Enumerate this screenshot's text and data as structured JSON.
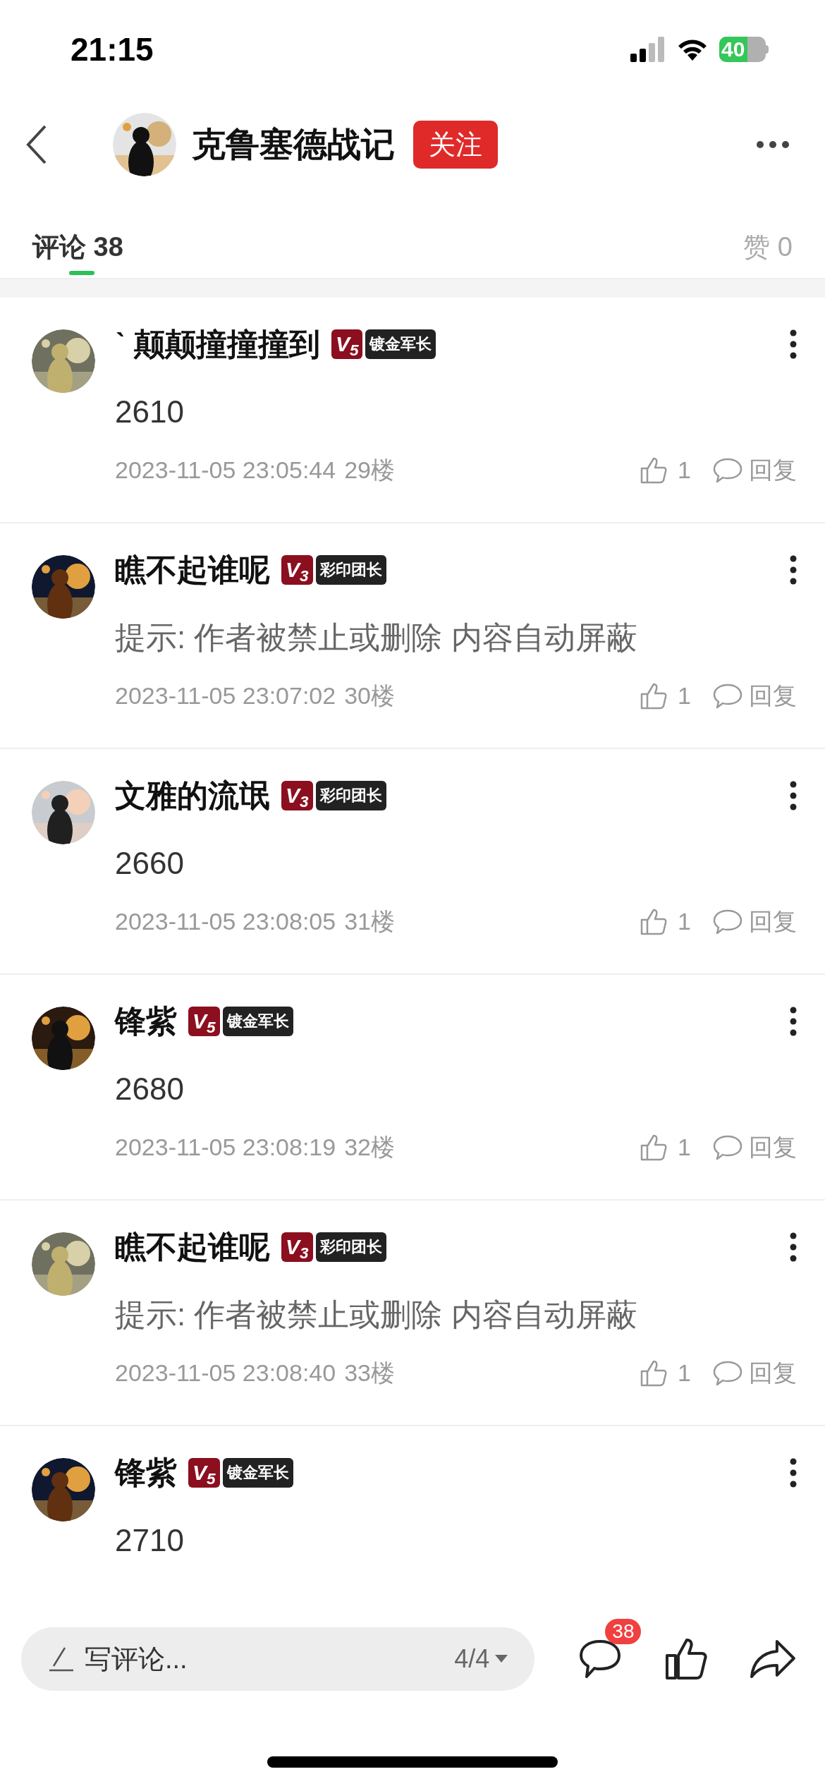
{
  "status_bar": {
    "time": "21:15",
    "battery": "40"
  },
  "header": {
    "title": "克鲁塞德战记",
    "follow_button": "关注"
  },
  "tabs": [
    {
      "label": "评论",
      "count": "38",
      "selected": true
    },
    {
      "label": "赞",
      "count": "0",
      "selected": false
    }
  ],
  "comments": [
    {
      "user": "ˋ 颠颠撞撞撞到",
      "rank": "V$_{5}$",
      "title": "镀金军长",
      "content": "2610",
      "kind": "normal",
      "time": "2023-11-05 23:05:44",
      "floor": "29楼",
      "likes": "1",
      "reply": "回复"
    },
    {
      "user": "瞧不起谁呢",
      "rank": "V$_{3}$",
      "title": "彩印团长",
      "content": "提示: 作者被禁止或删除 内容自动屏蔽",
      "kind": "blocked",
      "time": "2023-11-05 23:07:02",
      "floor": "30楼",
      "likes": "1",
      "reply": "回复"
    },
    {
      "user": "文雅的流氓",
      "rank": "V$_{3}$",
      "title": "彩印团长",
      "content": "2660",
      "kind": "normal",
      "time": "2023-11-05 23:08:05",
      "floor": "31楼",
      "likes": "1",
      "reply": "回复"
    },
    {
      "user": "锋紫",
      "rank": "V$_{5}$",
      "title": "镀金军长",
      "content": "2680",
      "kind": "normal",
      "time": "2023-11-05 23:08:19",
      "floor": "32楼",
      "likes": "1",
      "reply": "回复"
    },
    {
      "user": "瞧不起谁呢",
      "rank": "V$_{3}$",
      "title": "彩印团长",
      "content": "提示: 作者被禁止或删除 内容自动屏蔽",
      "kind": "blocked",
      "time": "2023-11-05 23:08:40",
      "floor": "33楼",
      "likes": "1",
      "reply": "回复"
    },
    {
      "user": "锋紫",
      "rank": "V$_{5}$",
      "title": "镀金军长",
      "content": "2710",
      "kind": "normal"
    }
  ],
  "bottom_bar": {
    "placeholder": "写评论...",
    "page": "4/4",
    "comment_count": "38"
  }
}
